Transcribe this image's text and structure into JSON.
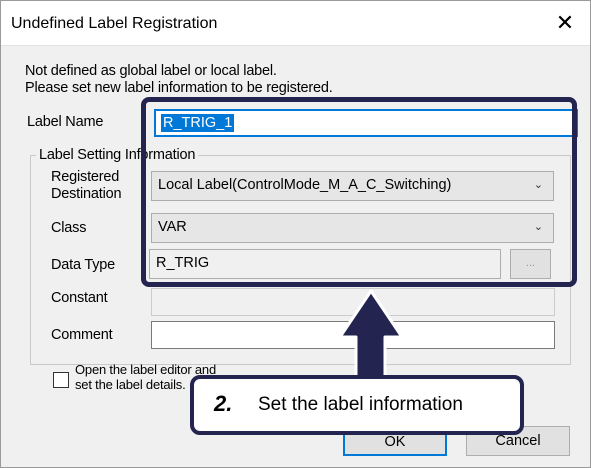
{
  "dialog": {
    "title": "Undefined Label Registration",
    "close_glyph": "✕",
    "message_line1": "Not defined as global label or local label.",
    "message_line2": "Please set new label information to be registered."
  },
  "label_name": {
    "label": "Label Name",
    "value": "R_TRIG_1"
  },
  "setting_group": {
    "title": "Label Setting Information",
    "registered_destination": {
      "label_line1": "Registered",
      "label_line2": "Destination",
      "value": "Local Label(ControlMode_M_A_C_Switching)"
    },
    "class": {
      "label": "Class",
      "value": "VAR"
    },
    "data_type": {
      "label": "Data Type",
      "value": "R_TRIG",
      "browse": "..."
    },
    "constant": {
      "label": "Constant",
      "value": ""
    },
    "comment": {
      "label": "Comment",
      "value": ""
    }
  },
  "open_editor_checkbox": {
    "line1": "Open the label editor and",
    "line2": "set the label details.",
    "checked": false
  },
  "buttons": {
    "ok": "OK",
    "cancel": "Cancel"
  },
  "annotation": {
    "step": "2.",
    "text": "Set the label information"
  },
  "colors": {
    "highlight": "#23244f",
    "selection": "#0078d7",
    "focus_border": "#0078d7"
  }
}
